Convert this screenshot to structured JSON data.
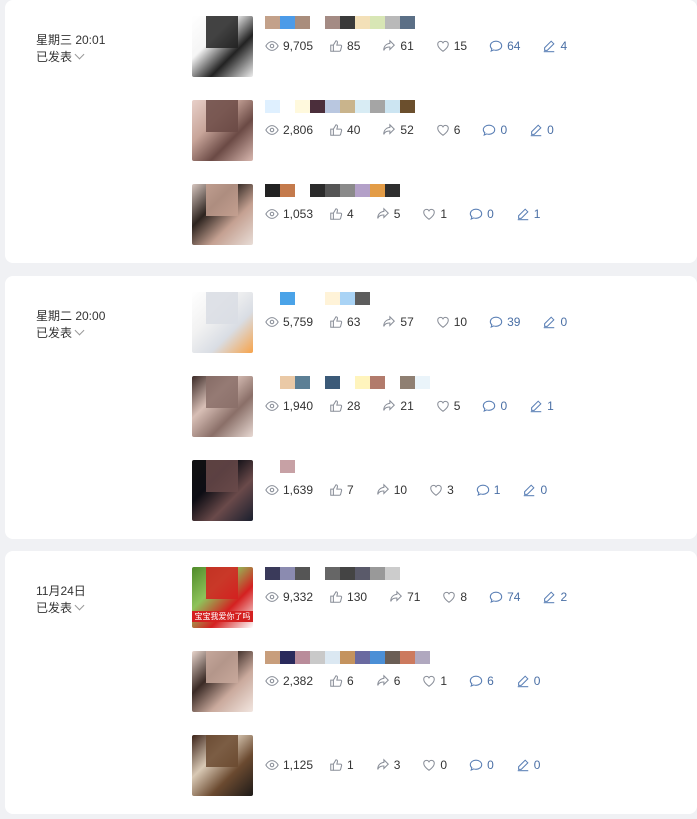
{
  "groups": [
    {
      "date": "星期三 20:01",
      "status": "已发表",
      "posts": [
        {
          "views": "9,705",
          "likes": "85",
          "shares": "61",
          "favorites": "15",
          "comments": "64",
          "edits": "4",
          "thumb_colors": [
            "#ffffff",
            "#f5f5f5",
            "#222222",
            "#eeeeee"
          ],
          "title_colors": [
            "#c3a18a",
            "#4c9be8",
            "#a98d7c",
            "#ffffff",
            "#a48b84",
            "#3a3a3a",
            "#f3e0b8",
            "#d8e6b5",
            "#b9b9b9",
            "#5b6f86"
          ]
        },
        {
          "views": "2,806",
          "likes": "40",
          "shares": "52",
          "favorites": "6",
          "comments": "0",
          "edits": "0",
          "thumb_colors": [
            "#e8d0c9",
            "#c8a59a",
            "#6b4a45",
            "#d9b8b0"
          ],
          "title_colors": [
            "#dff0ff",
            "#ffffff",
            "#fff9dd",
            "#4b2e3b",
            "#b9c7e0",
            "#c9b48c",
            "#d8ecf4",
            "#a5a5a5",
            "#cce5f2",
            "#6b4f2d",
            "#ffffff"
          ]
        },
        {
          "views": "1,053",
          "likes": "4",
          "shares": "5",
          "favorites": "1",
          "comments": "0",
          "edits": "1",
          "thumb_colors": [
            "#d7c6bf",
            "#2d241f",
            "#c4a091",
            "#e8ddd7"
          ],
          "title_colors": [
            "#222222",
            "#c47a4c",
            "#ffffff",
            "#2b2b2b",
            "#555555",
            "#8a8a8a",
            "#b3a0c8",
            "#e39c46",
            "#2f2f2f"
          ]
        }
      ]
    },
    {
      "date": "星期二 20:00",
      "status": "已发表",
      "posts": [
        {
          "views": "5,759",
          "likes": "63",
          "shares": "57",
          "favorites": "10",
          "comments": "39",
          "edits": "0",
          "thumb_colors": [
            "#ffffff",
            "#f2f2f2",
            "#d9dde4",
            "#f7a34a"
          ],
          "title_colors": [
            "#ffffff",
            "#4aa3e8",
            "#ffffff",
            "#ffffff",
            "#fff3d8",
            "#a9d3f5",
            "#5d5d5d"
          ]
        },
        {
          "views": "1,940",
          "likes": "28",
          "shares": "21",
          "favorites": "5",
          "comments": "0",
          "edits": "1",
          "thumb_colors": [
            "#3b2a27",
            "#d8bfb6",
            "#8a6f68",
            "#e8d9d3"
          ],
          "title_colors": [
            "#ffffff",
            "#eac9a6",
            "#5c7f95",
            "#ffffff",
            "#3b5a78",
            "#ffffff",
            "#fff4bd",
            "#b27b6c",
            "#ffffff",
            "#8f7f72",
            "#eaf4fa"
          ]
        },
        {
          "views": "1,639",
          "likes": "7",
          "shares": "10",
          "favorites": "3",
          "comments": "1",
          "edits": "0",
          "thumb_colors": [
            "#111111",
            "#0d0d14",
            "#6a4a4a",
            "#1a1f2e"
          ],
          "title_colors": [
            "#ffffff",
            "#c7a1a5"
          ]
        }
      ]
    },
    {
      "date": "11月24日",
      "status": "已发表",
      "posts": [
        {
          "views": "9,332",
          "likes": "130",
          "shares": "71",
          "favorites": "8",
          "comments": "74",
          "edits": "2",
          "thumb_colors": [
            "#4f8a2a",
            "#8ec35a",
            "#d42020",
            "#ffffff"
          ],
          "thumb_caption": "宝宝我爱你了吗",
          "title_colors": [
            "#3a3a5a",
            "#8b8bb0",
            "#555555",
            "#ffffff",
            "#666666",
            "#444444",
            "#5a5a6a",
            "#999999",
            "#cccccc"
          ]
        },
        {
          "views": "2,382",
          "likes": "6",
          "shares": "6",
          "favorites": "1",
          "comments": "6",
          "edits": "0",
          "thumb_colors": [
            "#e8d5cc",
            "#3a2a25",
            "#c9a99c",
            "#f2e6e0"
          ],
          "title_colors": [
            "#c89e7c",
            "#2a2a5c",
            "#b98c9a",
            "#c9c9c9",
            "#dbe8f2",
            "#c4935e",
            "#6a6aa0",
            "#4b8fd6",
            "#6b5e55",
            "#cc7a5e",
            "#b0a8bf"
          ]
        },
        {
          "views": "1,125",
          "likes": "1",
          "shares": "3",
          "favorites": "0",
          "comments": "0",
          "edits": "0",
          "thumb_colors": [
            "#3b2218",
            "#d9c9b5",
            "#6b4a30",
            "#1e1a18"
          ],
          "title_colors": [
            "#ffffff"
          ]
        }
      ]
    }
  ]
}
